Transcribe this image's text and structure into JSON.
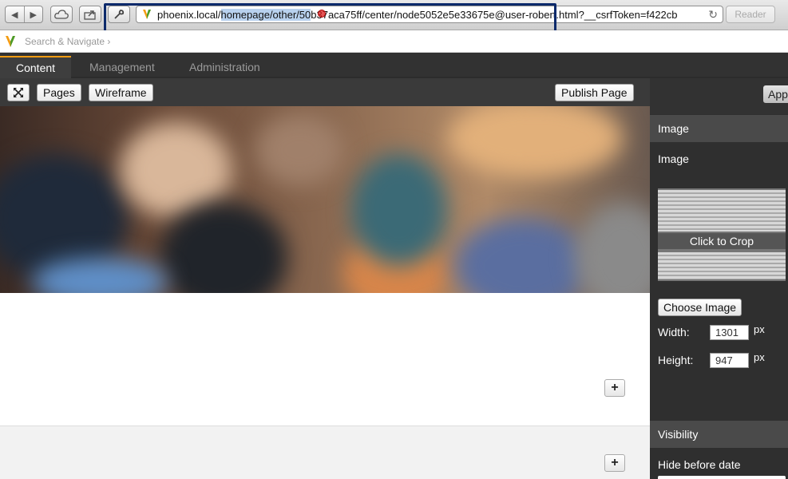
{
  "browser": {
    "url_host": "phoenix.local/",
    "url_selected": "homepage/other/50",
    "url_rest": "b37aca75ff/center/node5052e5e33675e@user-robert.html?__csrfToken=f422cb",
    "reader_label": "Reader",
    "icons": [
      "back-icon",
      "forward-icon",
      "cloud-icon",
      "share-icon",
      "wrench-icon",
      "reload-icon"
    ]
  },
  "neos": {
    "search_placeholder": "Search & Navigate",
    "search_chevron": "›"
  },
  "tabs": [
    {
      "label": "Content"
    },
    {
      "label": "Management"
    },
    {
      "label": "Administration"
    }
  ],
  "toolbar": {
    "fullscreen_icon": "fullscreen-icon",
    "pages_label": "Pages",
    "wireframe_label": "Wireframe",
    "publish_label": "Publish Page"
  },
  "content": {
    "plus_label": "+"
  },
  "inspector": {
    "apply_label": "App",
    "image_section_title": "Image",
    "image_label": "Image",
    "crop_label": "Click to Crop",
    "choose_label": "Choose Image",
    "width_label": "Width:",
    "width_value": "1301",
    "height_label": "Height:",
    "height_value": "947",
    "unit": "px",
    "visibility_title": "Visibility",
    "hide_before_label": "Hide before date"
  },
  "colors": {
    "accent": "#f39c12",
    "highlight_box": "#0c2a6b",
    "panel_dark": "#2f2f2f"
  }
}
